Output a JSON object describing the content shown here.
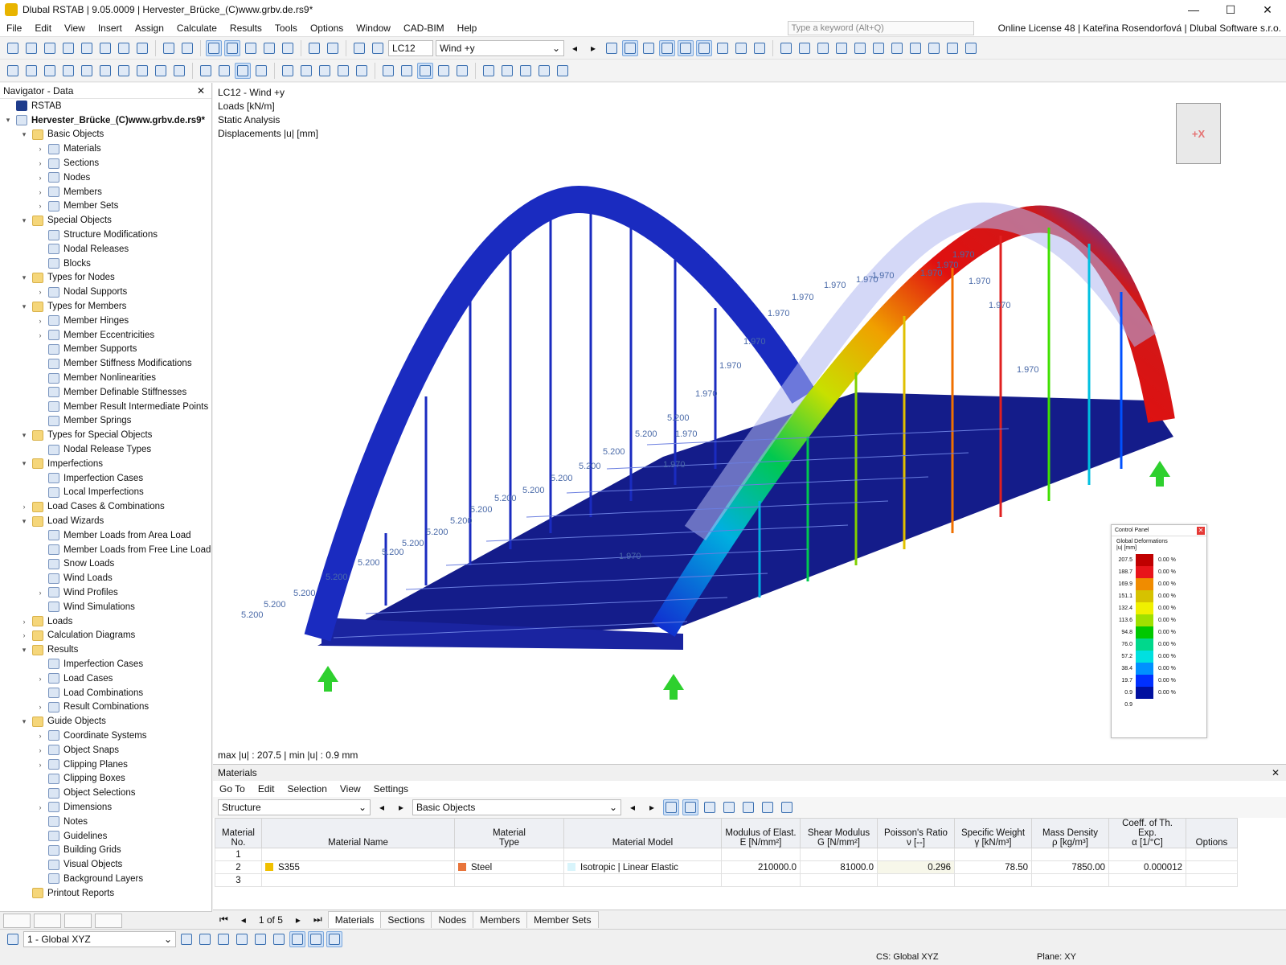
{
  "window": {
    "title": "Dlubal RSTAB | 9.05.0009 | Hervester_Brücke_(C)www.grbv.de.rs9*",
    "minimize": "—",
    "maximize": "☐",
    "close": "✕"
  },
  "menu": {
    "items": [
      "File",
      "Edit",
      "View",
      "Insert",
      "Assign",
      "Calculate",
      "Results",
      "Tools",
      "Options",
      "Window",
      "CAD-BIM",
      "Help"
    ],
    "search_placeholder": "Type a keyword (Alt+Q)",
    "license": "Online License 48 | Kateřina Rosendorfová | Dlubal Software s.r.o."
  },
  "toolbar": {
    "loadcase_id": "LC12",
    "loadcase_name": "Wind +y"
  },
  "navigator": {
    "title": "Navigator - Data",
    "items": [
      {
        "label": "RSTAB",
        "level": 0,
        "exp": "",
        "type": "root"
      },
      {
        "label": "Hervester_Brücke_(C)www.grbv.de.rs9*",
        "level": 0,
        "exp": "▾",
        "type": "item",
        "bold": true
      },
      {
        "label": "Basic Objects",
        "level": 1,
        "exp": "▾",
        "type": "folder"
      },
      {
        "label": "Materials",
        "level": 2,
        "exp": "›",
        "type": "item"
      },
      {
        "label": "Sections",
        "level": 2,
        "exp": "›",
        "type": "item"
      },
      {
        "label": "Nodes",
        "level": 2,
        "exp": "›",
        "type": "item"
      },
      {
        "label": "Members",
        "level": 2,
        "exp": "›",
        "type": "item"
      },
      {
        "label": "Member Sets",
        "level": 2,
        "exp": "›",
        "type": "item"
      },
      {
        "label": "Special Objects",
        "level": 1,
        "exp": "▾",
        "type": "folder"
      },
      {
        "label": "Structure Modifications",
        "level": 2,
        "exp": "",
        "type": "item"
      },
      {
        "label": "Nodal Releases",
        "level": 2,
        "exp": "",
        "type": "item"
      },
      {
        "label": "Blocks",
        "level": 2,
        "exp": "",
        "type": "item"
      },
      {
        "label": "Types for Nodes",
        "level": 1,
        "exp": "▾",
        "type": "folder"
      },
      {
        "label": "Nodal Supports",
        "level": 2,
        "exp": "›",
        "type": "item"
      },
      {
        "label": "Types for Members",
        "level": 1,
        "exp": "▾",
        "type": "folder"
      },
      {
        "label": "Member Hinges",
        "level": 2,
        "exp": "›",
        "type": "item"
      },
      {
        "label": "Member Eccentricities",
        "level": 2,
        "exp": "›",
        "type": "item"
      },
      {
        "label": "Member Supports",
        "level": 2,
        "exp": "",
        "type": "item"
      },
      {
        "label": "Member Stiffness Modifications",
        "level": 2,
        "exp": "",
        "type": "item"
      },
      {
        "label": "Member Nonlinearities",
        "level": 2,
        "exp": "",
        "type": "item"
      },
      {
        "label": "Member Definable Stiffnesses",
        "level": 2,
        "exp": "",
        "type": "item"
      },
      {
        "label": "Member Result Intermediate Points",
        "level": 2,
        "exp": "",
        "type": "item"
      },
      {
        "label": "Member Springs",
        "level": 2,
        "exp": "",
        "type": "item"
      },
      {
        "label": "Types for Special Objects",
        "level": 1,
        "exp": "▾",
        "type": "folder"
      },
      {
        "label": "Nodal Release Types",
        "level": 2,
        "exp": "",
        "type": "item"
      },
      {
        "label": "Imperfections",
        "level": 1,
        "exp": "▾",
        "type": "folder"
      },
      {
        "label": "Imperfection Cases",
        "level": 2,
        "exp": "",
        "type": "item"
      },
      {
        "label": "Local Imperfections",
        "level": 2,
        "exp": "",
        "type": "item"
      },
      {
        "label": "Load Cases & Combinations",
        "level": 1,
        "exp": "›",
        "type": "folder"
      },
      {
        "label": "Load Wizards",
        "level": 1,
        "exp": "▾",
        "type": "folder"
      },
      {
        "label": "Member Loads from Area Load",
        "level": 2,
        "exp": "",
        "type": "item"
      },
      {
        "label": "Member Loads from Free Line Load",
        "level": 2,
        "exp": "",
        "type": "item"
      },
      {
        "label": "Snow Loads",
        "level": 2,
        "exp": "",
        "type": "item"
      },
      {
        "label": "Wind Loads",
        "level": 2,
        "exp": "",
        "type": "item"
      },
      {
        "label": "Wind Profiles",
        "level": 2,
        "exp": "›",
        "type": "item"
      },
      {
        "label": "Wind Simulations",
        "level": 2,
        "exp": "",
        "type": "item"
      },
      {
        "label": "Loads",
        "level": 1,
        "exp": "›",
        "type": "folder"
      },
      {
        "label": "Calculation Diagrams",
        "level": 1,
        "exp": "›",
        "type": "folder"
      },
      {
        "label": "Results",
        "level": 1,
        "exp": "▾",
        "type": "folder"
      },
      {
        "label": "Imperfection Cases",
        "level": 2,
        "exp": "",
        "type": "item"
      },
      {
        "label": "Load Cases",
        "level": 2,
        "exp": "›",
        "type": "item"
      },
      {
        "label": "Load Combinations",
        "level": 2,
        "exp": "",
        "type": "item"
      },
      {
        "label": "Result Combinations",
        "level": 2,
        "exp": "›",
        "type": "item"
      },
      {
        "label": "Guide Objects",
        "level": 1,
        "exp": "▾",
        "type": "folder"
      },
      {
        "label": "Coordinate Systems",
        "level": 2,
        "exp": "›",
        "type": "item"
      },
      {
        "label": "Object Snaps",
        "level": 2,
        "exp": "›",
        "type": "item"
      },
      {
        "label": "Clipping Planes",
        "level": 2,
        "exp": "›",
        "type": "item"
      },
      {
        "label": "Clipping Boxes",
        "level": 2,
        "exp": "",
        "type": "item"
      },
      {
        "label": "Object Selections",
        "level": 2,
        "exp": "",
        "type": "item"
      },
      {
        "label": "Dimensions",
        "level": 2,
        "exp": "›",
        "type": "item"
      },
      {
        "label": "Notes",
        "level": 2,
        "exp": "",
        "type": "item"
      },
      {
        "label": "Guidelines",
        "level": 2,
        "exp": "",
        "type": "item"
      },
      {
        "label": "Building Grids",
        "level": 2,
        "exp": "",
        "type": "item"
      },
      {
        "label": "Visual Objects",
        "level": 2,
        "exp": "",
        "type": "item"
      },
      {
        "label": "Background Layers",
        "level": 2,
        "exp": "",
        "type": "item"
      },
      {
        "label": "Printout Reports",
        "level": 1,
        "exp": "",
        "type": "folder"
      }
    ]
  },
  "viewport": {
    "info_lines": [
      "LC12 - Wind +y",
      "Loads [kN/m]",
      "Static Analysis",
      "Displacements |u| [mm]"
    ],
    "maxmin": "max |u| : 207.5 | min |u| : 0.9 mm",
    "cube_label": "+X",
    "load_labels_left": [
      "5.200",
      "5.200",
      "5.200",
      "5.200",
      "5.200",
      "5.200",
      "5.200",
      "5.200",
      "5.200",
      "5.200",
      "5.200",
      "5.200",
      "5.200",
      "5.200",
      "5.200",
      "5.200",
      "5.200"
    ],
    "load_labels_right": [
      "1.970",
      "1.970",
      "1.970",
      "1.970",
      "1.970",
      "1.970",
      "1.970",
      "1.970",
      "1.970",
      "1.970",
      "1.970",
      "1.970",
      "1.970",
      "1.970",
      "1.970",
      "1.970",
      "1.970"
    ]
  },
  "control_panel": {
    "title": "Control Panel",
    "subtitle": "Global Deformations",
    "unit": "|u| [mm]",
    "legend": [
      {
        "value": "207.5",
        "color": "#c00000",
        "pct": "0.00 %"
      },
      {
        "value": "188.7",
        "color": "#e8141a",
        "pct": "0.00 %"
      },
      {
        "value": "169.9",
        "color": "#f08c00",
        "pct": "0.00 %"
      },
      {
        "value": "151.1",
        "color": "#d6c200",
        "pct": "0.00 %"
      },
      {
        "value": "132.4",
        "color": "#f0f000",
        "pct": "0.00 %"
      },
      {
        "value": "113.6",
        "color": "#a0e000",
        "pct": "0.00 %"
      },
      {
        "value": "94.8",
        "color": "#00c800",
        "pct": "0.00 %"
      },
      {
        "value": "76.0",
        "color": "#00d88c",
        "pct": "0.00 %"
      },
      {
        "value": "57.2",
        "color": "#00e0e0",
        "pct": "0.00 %"
      },
      {
        "value": "38.4",
        "color": "#0090ff",
        "pct": "0.00 %"
      },
      {
        "value": "19.7",
        "color": "#0030ff",
        "pct": "0.00 %"
      },
      {
        "value": "0.9",
        "color": "#0010a0",
        "pct": "0.00 %"
      }
    ],
    "last_value": "0.9"
  },
  "materials_panel": {
    "title": "Materials",
    "menu": [
      "Go To",
      "Edit",
      "Selection",
      "View",
      "Settings"
    ],
    "structure_combo": "Structure",
    "objects_combo": "Basic Objects",
    "columns": [
      {
        "line1": "Material",
        "line2": "No."
      },
      {
        "line1": "",
        "line2": "Material Name"
      },
      {
        "line1": "Material",
        "line2": "Type"
      },
      {
        "line1": "",
        "line2": "Material Model"
      },
      {
        "line1": "Modulus of Elast.",
        "line2": "E [N/mm²]"
      },
      {
        "line1": "Shear Modulus",
        "line2": "G [N/mm²]"
      },
      {
        "line1": "Poisson's Ratio",
        "line2": "ν [--]"
      },
      {
        "line1": "Specific Weight",
        "line2": "γ [kN/m³]"
      },
      {
        "line1": "Mass Density",
        "line2": "ρ [kg/m³]"
      },
      {
        "line1": "Coeff. of Th. Exp.",
        "line2": "α [1/°C]"
      },
      {
        "line1": "",
        "line2": "Options"
      }
    ],
    "rows": [
      {
        "no": "1",
        "name": "",
        "type": "",
        "model": "",
        "E": "",
        "G": "",
        "nu": "",
        "gamma": "",
        "rho": "",
        "alpha": ""
      },
      {
        "no": "2",
        "name": "S355",
        "type": "Steel",
        "model": "Isotropic | Linear Elastic",
        "E": "210000.0",
        "G": "81000.0",
        "nu": "0.296",
        "gamma": "78.50",
        "rho": "7850.00",
        "alpha": "0.000012"
      },
      {
        "no": "3",
        "name": "",
        "type": "",
        "model": "",
        "E": "",
        "G": "",
        "nu": "",
        "gamma": "",
        "rho": "",
        "alpha": ""
      }
    ],
    "name_color": "#f0c000",
    "type_color": "#e8743a",
    "model_color": "#d8f4fb",
    "pager": "1 of 5",
    "tabs": [
      "Materials",
      "Sections",
      "Nodes",
      "Members",
      "Member Sets"
    ]
  },
  "statusbar": {
    "coord_system": "1 - Global XYZ",
    "cs": "CS: Global XYZ",
    "plane": "Plane: XY"
  }
}
